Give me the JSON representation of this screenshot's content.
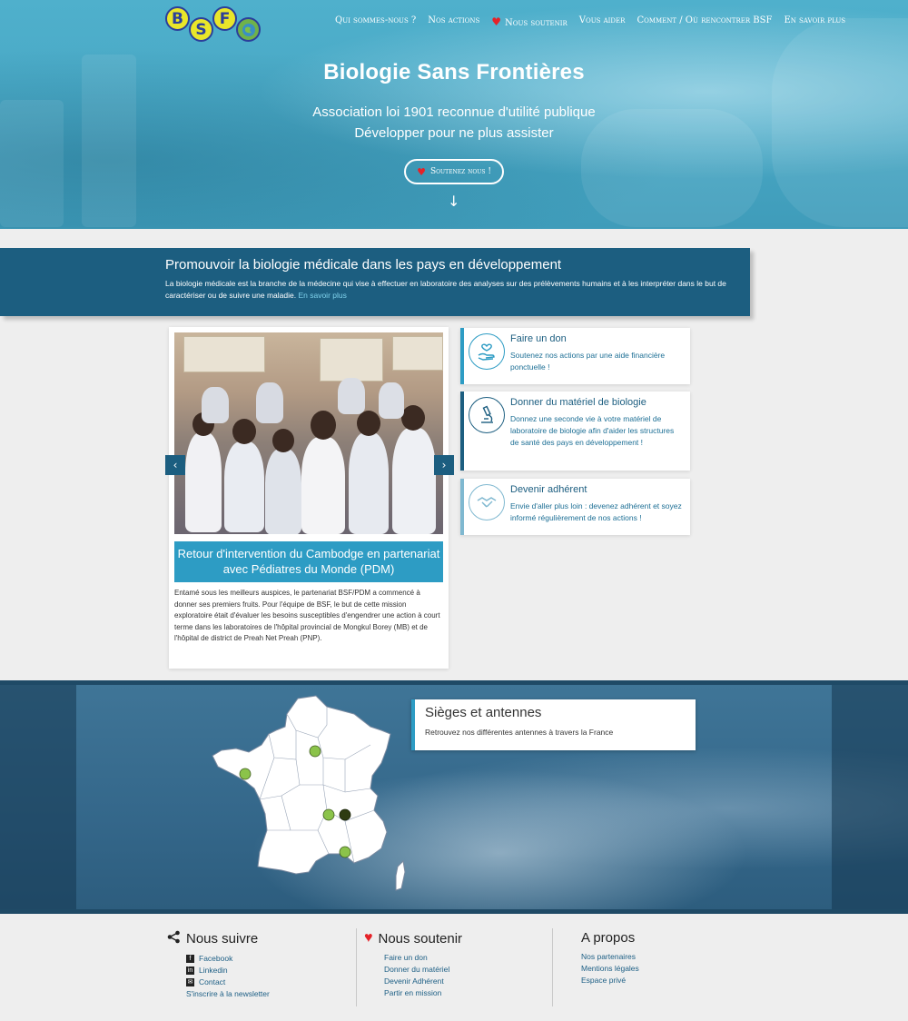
{
  "header": {
    "logo_letters": [
      "B",
      "S",
      "F"
    ],
    "nav": [
      {
        "label": "Qui sommes-nous ?"
      },
      {
        "label": "Nos actions"
      },
      {
        "label": "Nous soutenir",
        "icon": "heart-icon"
      },
      {
        "label": "Vous aider"
      },
      {
        "label": "Comment / Où rencontrer BSF"
      },
      {
        "label": "En savoir plus"
      }
    ]
  },
  "hero": {
    "title": "Biologie Sans Frontières",
    "subtitle_1": "Association loi 1901 reconnue d'utilité publique",
    "subtitle_2": "Développer pour ne plus assister",
    "button_label": "Soutenez nous !",
    "arrow": "↓"
  },
  "promo": {
    "title": "Promouvoir la biologie médicale dans les pays en développement",
    "text": "La biologie médicale est la branche de la médecine qui vise à effectuer en laboratoire des analyses sur des prélèvements humains et à les interpréter dans le but de caractériser ou de suivre une maladie. ",
    "link": "En savoir plus"
  },
  "slider": {
    "caption": "Retour d'intervention du Cambodge en partenariat avec Pédiatres du Monde (PDM)",
    "text": "Entamé sous les meilleurs auspices, le partenariat BSF/PDM a commencé à donner ses premiers fruits. Pour l'équipe de BSF, le but de cette mission exploratoire était d'évaluer les besoins susceptibles d'engendrer une action à court terme dans les laboratoires de l'hôpital provincial de Mongkul Borey (MB) et de l'hôpital de district de Preah Net Preah (PNP).",
    "prev": "‹",
    "next": "›"
  },
  "actions": [
    {
      "title": "Faire un don",
      "text": "Soutenez nos actions par une aide financière ponctuelle !",
      "icon": "donation-hand-icon",
      "accent": "#2d9cc4"
    },
    {
      "title": "Donner du matériel de biologie",
      "text": "Donnez une seconde vie à votre matériel de laboratoire de biologie afin d'aider les structures de santé des pays en développement !",
      "icon": "microscope-icon",
      "accent": "#1c5e80"
    },
    {
      "title": "Devenir adhérent",
      "text": "Envie d'aller plus loin : devenez adhérent et soyez informé régulièrement de nos actions !",
      "icon": "handshake-icon",
      "accent": "#7fb8d0"
    }
  ],
  "map": {
    "title": "Sièges et antennes",
    "text": "Retrouvez nos différentes antennes à travers la France"
  },
  "footer": {
    "follow": {
      "title": "Nous suivre",
      "items": [
        {
          "label": "Facebook",
          "icon": "facebook-icon"
        },
        {
          "label": "Linkedin",
          "icon": "linkedin-icon"
        },
        {
          "label": "Contact",
          "icon": "mail-icon"
        },
        {
          "label": "S'inscrire à la newsletter",
          "icon": ""
        }
      ]
    },
    "support": {
      "title": "Nous soutenir",
      "items": [
        "Faire un don",
        "Donner du matériel",
        "Devenir Adhérent",
        "Partir en mission"
      ]
    },
    "about": {
      "title": "A propos",
      "items": [
        "Nos partenaires",
        "Mentions légales",
        "Espace privé"
      ]
    }
  },
  "colors": {
    "hero_blue": "#48a7c4",
    "dark_blue": "#1c5e80",
    "accent_blue": "#2d9cc4",
    "heart_red": "#e52228",
    "marker_green": "#8bc34a",
    "marker_dark": "#2e3b12"
  }
}
